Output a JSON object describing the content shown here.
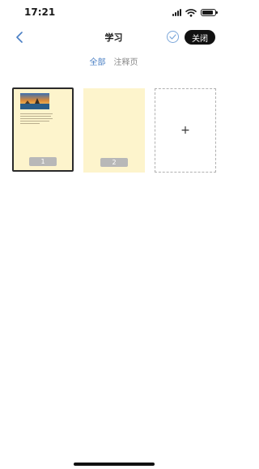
{
  "status_bar": {
    "time": "17:21"
  },
  "header": {
    "title": "学习",
    "close_label": "关闭"
  },
  "tabs": [
    {
      "label": "全部"
    },
    {
      "label": "注释页"
    }
  ],
  "pages": [
    {
      "number": "1"
    },
    {
      "number": "2"
    }
  ],
  "add_card": {
    "symbol": "+"
  },
  "colors": {
    "accent": "#4a7fc4",
    "card_background": "#fdf4cc",
    "close_button": "#111111"
  }
}
